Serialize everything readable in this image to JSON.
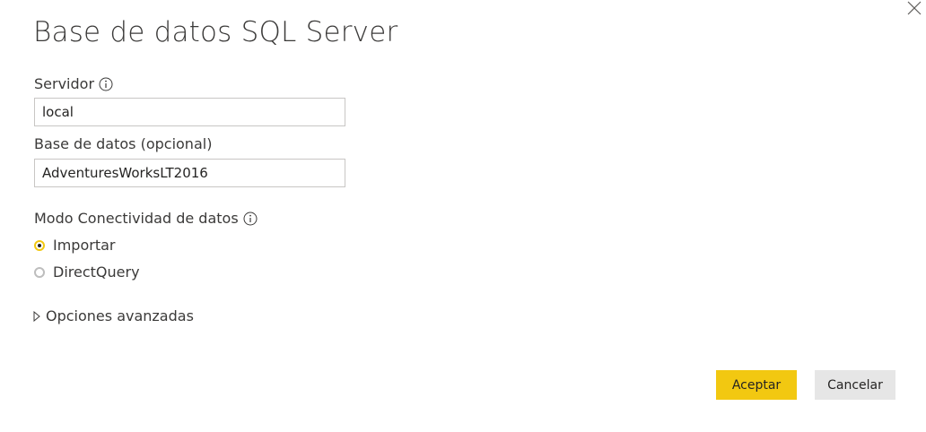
{
  "dialog": {
    "title": "Base de datos SQL Server",
    "close_icon": "close-icon"
  },
  "server": {
    "label": "Servidor",
    "value": "local",
    "info_icon": "info-icon"
  },
  "database": {
    "label": "Base de datos (opcional)",
    "value": "AdventuresWorksLT2016"
  },
  "connectivity": {
    "label": "Modo Conectividad de datos",
    "info_icon": "info-icon",
    "options": [
      {
        "label": "Importar",
        "selected": true
      },
      {
        "label": "DirectQuery",
        "selected": false
      }
    ]
  },
  "advanced": {
    "label": "Opciones avanzadas",
    "expand_icon": "triangle-right-icon"
  },
  "buttons": {
    "ok": "Aceptar",
    "cancel": "Cancelar"
  },
  "colors": {
    "accent": "#f2c811",
    "cancel_bg": "#e6e6e6",
    "text": "#3b3a39"
  }
}
